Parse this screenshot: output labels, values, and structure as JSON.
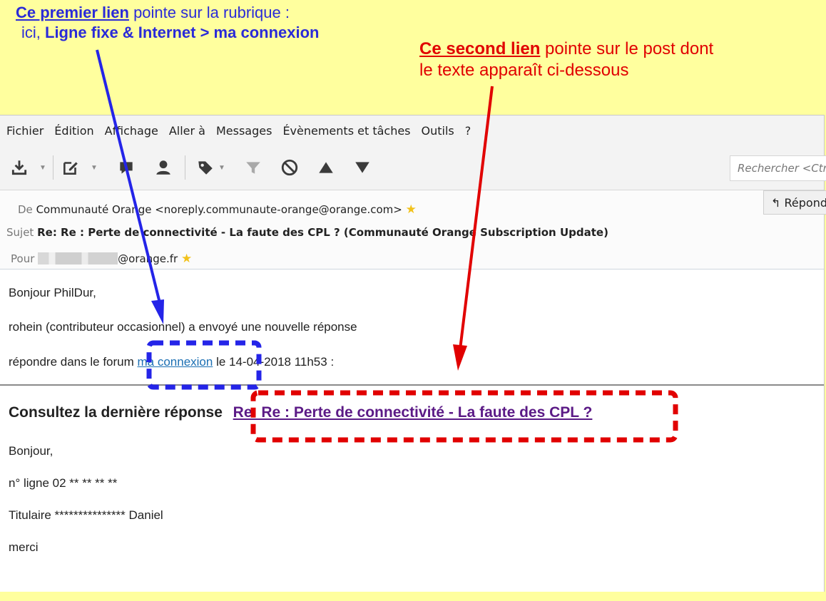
{
  "annotations": {
    "blue": {
      "underlined": "Ce premier lien",
      "rest": " pointe sur la rubrique :",
      "line2_prefix": "ici, ",
      "line2_bold": "Ligne fixe & Internet > ma connexion"
    },
    "red": {
      "underlined": "Ce second lien",
      "rest": " pointe sur le post dont",
      "line2": "le texte apparaît ci-dessous"
    }
  },
  "menu": [
    "Fichier",
    "Édition",
    "Affichage",
    "Aller à",
    "Messages",
    "Évènements et tâches",
    "Outils",
    "?"
  ],
  "toolbar": {
    "search_placeholder": "Rechercher <Ctrl+K>",
    "icons": [
      "download-icon",
      "compose-icon",
      "chat-icon",
      "contact-icon",
      "tag-icon",
      "filter-icon",
      "block-icon",
      "up-arrow-icon",
      "down-arrow-icon"
    ]
  },
  "headers": {
    "from_label": "De",
    "from_value": "Communauté Orange <noreply.communaute-orange@orange.com>",
    "subject_label": "Sujet",
    "subject_value": "Re: Re : Perte de connectivité - La faute des CPL ? (Communauté Orange Subscription Update)",
    "to_label": "Pour",
    "to_value": "@orange.fr",
    "reply_label": "Répondre"
  },
  "body": {
    "greeting": "Bonjour PhilDur,",
    "line2": "rohein (contributeur occasionnel) a envoyé une nouvelle réponse",
    "line3_prefix": "répondre dans le forum ",
    "line3_link": "ma connexion",
    "line3_suffix": " le 14-04-2018 11h53 :",
    "consult_label": "Consultez la dernière réponse",
    "consult_link": "Re: Re : Perte de connectivité - La faute des CPL ?",
    "post_lines": [
      "Bonjour,",
      "n° ligne 02 ** ** ** **",
      "Titulaire *************** Daniel",
      "merci"
    ]
  },
  "colors": {
    "background": "#ffff9e",
    "blue_annotation": "#2a2ad8",
    "red_annotation": "#e10000",
    "link": "#1b6fb3",
    "visited_link": "#5b1a86"
  }
}
